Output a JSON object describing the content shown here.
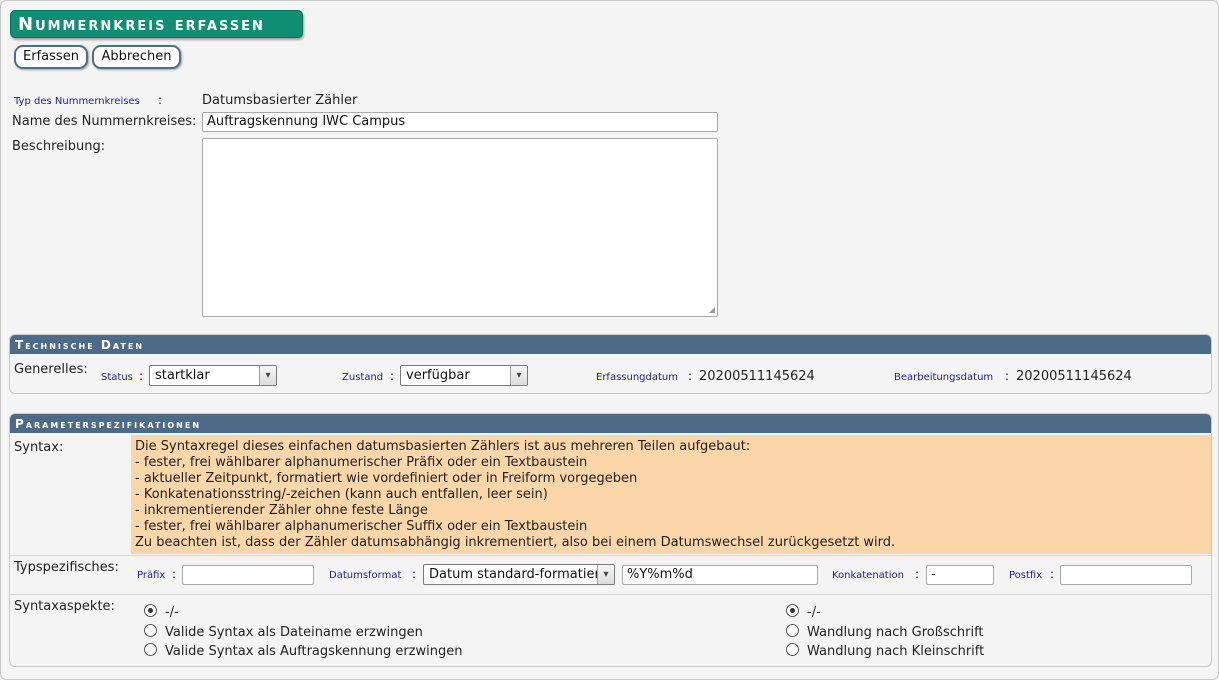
{
  "title": "Nummernkreis erfassen",
  "toolbar": {
    "submit_label": "Erfassen",
    "cancel_label": "Abbrechen"
  },
  "form": {
    "type_label": "Typ des Nummernkreises",
    "type_value": "Datumsbasierter Zähler",
    "name_label": "Name des Nummernkreises:",
    "name_value": "Auftragskennung IWC Campus",
    "description_label": "Beschreibung:",
    "description_value": ""
  },
  "technical": {
    "heading": "Technische Daten",
    "general_label": "Generelles:",
    "status_label": "Status",
    "status_value": "startklar",
    "state_label": "Zustand",
    "state_value": "verfügbar",
    "created_label": "Erfassungdatum",
    "created_value": "20200511145624",
    "edited_label": "Bearbeitungsdatum",
    "edited_value": "20200511145624"
  },
  "parameters": {
    "heading": "Parameterspezifikationen",
    "syntax_label": "Syntax:",
    "syntax_lines": [
      "Die Syntaxregel dieses einfachen datumsbasierten Zählers ist aus mehreren Teilen aufgebaut:",
      "- fester, frei wählbarer alphanumerischer Präfix oder ein Textbaustein",
      "- aktueller Zeitpunkt, formatiert wie vordefiniert oder in Freiform vorgegeben",
      "- Konkatenationsstring/-zeichen (kann auch entfallen, leer sein)",
      "- inkrementierender Zähler ohne feste Länge",
      "- fester, frei wählbarer alphanumerischer Suffix oder ein Textbaustein",
      "Zu beachten ist, dass der Zähler datumsabhängig inkrementiert, also bei einem Datumswechsel zurückgesetzt wird."
    ],
    "type_specific_label": "Typspezifisches:",
    "prefix_label": "Präfix",
    "prefix_value": "",
    "dateformat_label": "Datumsformat",
    "dateformat_select": "Datum standard-formatiert",
    "dateformat_value": "%Y%m%d",
    "concat_label": "Konkatenation",
    "concat_value": "-",
    "postfix_label": "Postfix",
    "postfix_value": "",
    "aspects_label": "Syntaxaspekte:",
    "aspects_left": [
      {
        "label": "-/-",
        "checked": true
      },
      {
        "label": "Valide Syntax als Dateiname erzwingen",
        "checked": false
      },
      {
        "label": "Valide Syntax als Auftragskennung erzwingen",
        "checked": false
      }
    ],
    "aspects_right": [
      {
        "label": "-/-",
        "checked": true
      },
      {
        "label": "Wandlung nach Großschrift",
        "checked": false
      },
      {
        "label": "Wandlung nach Kleinschrift",
        "checked": false
      }
    ]
  },
  "colors": {
    "title_bg": "#0e8f74",
    "section_header_bg": "#4d6a86",
    "syntax_bg": "#fbd6a8",
    "label_blue": "#1a1aa6"
  }
}
